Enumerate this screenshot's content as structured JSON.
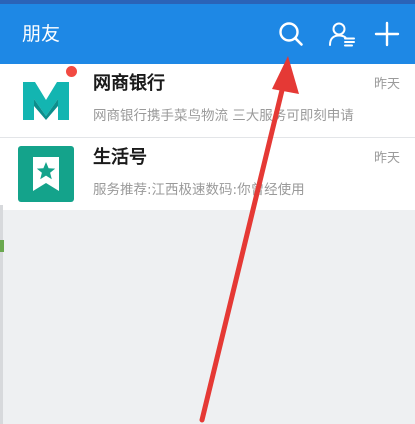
{
  "header": {
    "title": "朋友",
    "icons": [
      "search-icon",
      "contacts-icon",
      "add-icon"
    ],
    "color": "#1e88e5"
  },
  "contacts": [
    {
      "name": "网商银行",
      "time": "昨天",
      "preview": "网商银行携手菜鸟物流 三大服务可即刻申请",
      "avatar": "mybank-logo",
      "avatar_color": "#13b5b1",
      "unread_dot": true
    },
    {
      "name": "生活号",
      "time": "昨天",
      "preview": "服务推荐:江西极速数码:你曾经使用",
      "avatar": "lifestyle-bookmark-star-icon",
      "avatar_color": "#14a38b",
      "unread_dot": false
    }
  ],
  "annotation": {
    "type": "arrow",
    "color": "#e53935",
    "points_to": "search-icon"
  }
}
